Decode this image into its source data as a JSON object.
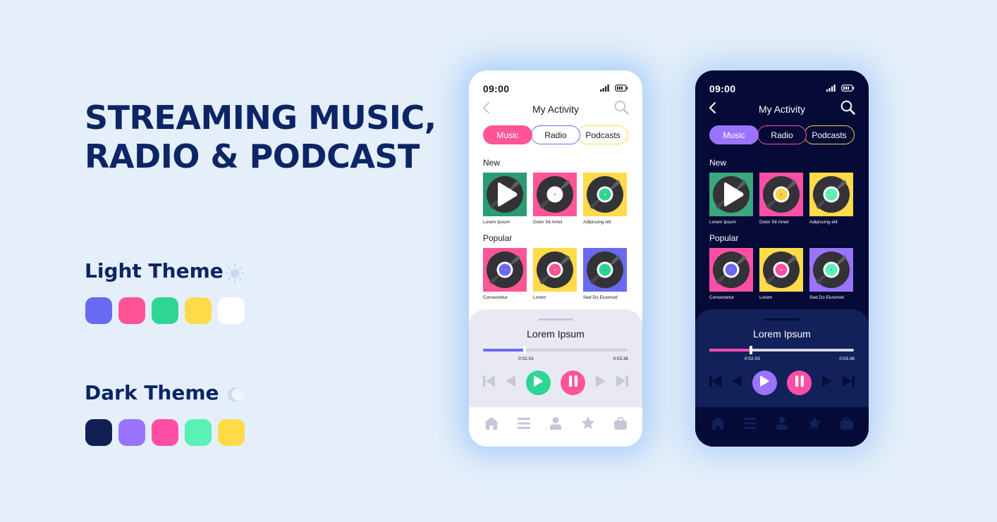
{
  "headline": {
    "line1": "STREAMING MUSIC,",
    "line2": "RADIO & PODCAST"
  },
  "themes": {
    "light": {
      "label": "Light Theme",
      "icon": "sun-icon",
      "swatches": [
        "#686af0",
        "#ff5596",
        "#2fd595",
        "#ffdb4a",
        "#ffffff"
      ]
    },
    "dark": {
      "label": "Dark Theme",
      "icon": "moon-icon",
      "swatches": [
        "#111f52",
        "#9a74ff",
        "#ff4fa5",
        "#5af0b6",
        "#ffdb4a"
      ]
    }
  },
  "phones": {
    "light": {
      "status": {
        "time": "09:00",
        "icons": [
          "signal-icon",
          "battery-icon"
        ]
      },
      "nav": {
        "title": "My Activity",
        "back_icon": "chevron-left-icon",
        "search_icon": "search-icon"
      },
      "tabs": [
        {
          "label": "Music",
          "active": true
        },
        {
          "label": "Radio",
          "active": false
        },
        {
          "label": "Podcasts",
          "active": false
        }
      ],
      "sections": {
        "new": {
          "title": "New",
          "items": [
            {
              "label": "Lorem Ipsum",
              "bg": "#2a9c70",
              "center": "play",
              "label_color": "#2a9c70"
            },
            {
              "label": "Dolor Sit Amet",
              "bg": "#ff5596",
              "center": "#ffffff",
              "dot": "#ff5596"
            },
            {
              "label": "Adipiscing elit",
              "bg": "#ffdb4a",
              "center": "#2fd595",
              "dot": "#ffdb4a"
            }
          ]
        },
        "popular": {
          "title": "Popular",
          "items": [
            {
              "label": "Consectetur",
              "bg": "#ff5596",
              "center": "#686af0",
              "dot": "#ff5596"
            },
            {
              "label": "Lorem",
              "bg": "#ffdb4a",
              "center": "#ff5596",
              "dot": "#ffdb4a"
            },
            {
              "label": "Sed Do Eiusmod",
              "bg": "#686af0",
              "center": "#2fd595",
              "dot": "#686af0"
            }
          ]
        }
      },
      "player": {
        "title": "Lorem Ipsum",
        "elapsed": "0:02.03",
        "total": "0:03.36",
        "progress": 0.29,
        "controls": [
          "skip-back-icon",
          "rewind-icon",
          "play-icon",
          "pause-icon",
          "forward-icon",
          "skip-forward-icon"
        ],
        "inactive_color": "#c7c9d7"
      },
      "tabbar": {
        "items": [
          "home-icon",
          "menu-icon",
          "profile-icon",
          "star-icon",
          "bag-icon"
        ],
        "color": "#c4c7d6"
      }
    },
    "dark": {
      "status": {
        "time": "09:00",
        "icons": [
          "signal-icon",
          "battery-icon"
        ]
      },
      "nav": {
        "title": "My Activity",
        "back_icon": "chevron-left-icon",
        "search_icon": "search-icon"
      },
      "tabs": [
        {
          "label": "Music",
          "active": true
        },
        {
          "label": "Radio",
          "active": false
        },
        {
          "label": "Podcasts",
          "active": false
        }
      ],
      "sections": {
        "new": {
          "title": "New",
          "items": [
            {
              "label": "Lorem Ipsum",
              "bg": "#3aa87e",
              "center": "play"
            },
            {
              "label": "Dolor Sit Amet",
              "bg": "#ff4fa5",
              "center": "#ffd23f",
              "dot": "#ff4fa5"
            },
            {
              "label": "Adipiscing elit",
              "bg": "#ffdb4a",
              "center": "#5af0b6",
              "dot": "#ffdb4a"
            }
          ]
        },
        "popular": {
          "title": "Popular",
          "items": [
            {
              "label": "Consectetur",
              "bg": "#ff4fa5",
              "center": "#686af0",
              "dot": "#ff4fa5"
            },
            {
              "label": "Lorem",
              "bg": "#ffdb4a",
              "center": "#ff4fa5",
              "dot": "#ffdb4a"
            },
            {
              "label": "Sed Do Eiusmod",
              "bg": "#9a74ff",
              "center": "#5af0b6",
              "dot": "#9a74ff"
            }
          ]
        }
      },
      "player": {
        "title": "Lorem Ipsum",
        "elapsed": "0:02.03",
        "total": "0:03.36",
        "progress": 0.29,
        "controls": [
          "skip-back-icon",
          "rewind-icon",
          "play-icon",
          "pause-icon",
          "forward-icon",
          "skip-forward-icon"
        ],
        "inactive_color": "#070c3a"
      },
      "tabbar": {
        "items": [
          "home-icon",
          "menu-icon",
          "profile-icon",
          "star-icon",
          "bag-icon"
        ],
        "color": "#12215a"
      }
    }
  }
}
